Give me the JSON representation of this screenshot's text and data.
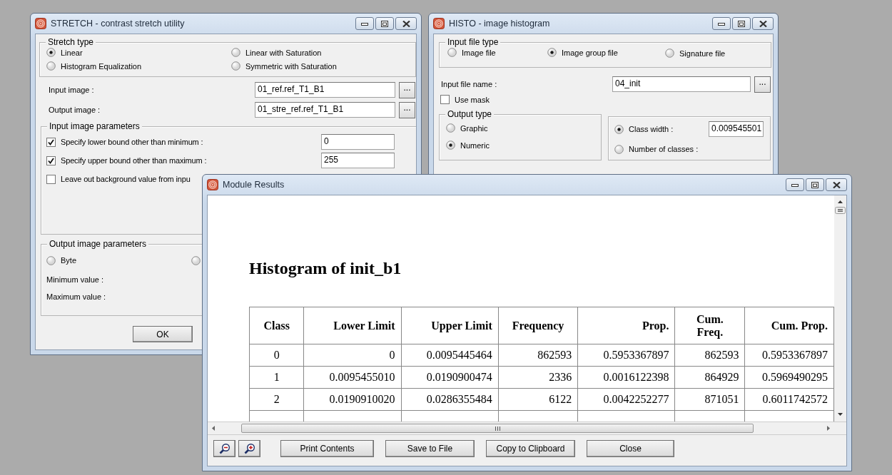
{
  "stretch_window": {
    "title": "STRETCH - contrast stretch utility",
    "stretch_type": {
      "label": "Stretch type",
      "options": [
        {
          "label": "Linear",
          "selected": true
        },
        {
          "label": "Linear with Saturation",
          "selected": false
        },
        {
          "label": "Histogram Equalization",
          "selected": false
        },
        {
          "label": "Symmetric with Saturation",
          "selected": false
        }
      ]
    },
    "fields": [
      {
        "label": "Input image :",
        "value": "01_ref.ref_T1_B1",
        "browse": "..."
      },
      {
        "label": "Output image :",
        "value": "01_stre_ref.ref_T1_B1",
        "browse": "..."
      }
    ],
    "input_parameters": {
      "label": "Input image parameters",
      "options": [
        {
          "label": "Specify lower bound other than minimum :",
          "checked": true,
          "value": "0"
        },
        {
          "label": "Specify upper bound other than maximum :",
          "checked": true,
          "value": "255"
        },
        {
          "label": "Leave out background value from inpu",
          "checked": false
        }
      ]
    },
    "output_parameters": {
      "label": "Output image parameters",
      "options": [
        {
          "label": "Byte",
          "selected": false
        },
        {
          "selected": false
        }
      ],
      "labels": [
        "Minimum value :",
        "Maximum value :"
      ]
    },
    "buttons": [
      "OK"
    ]
  },
  "histo_window": {
    "title": "HISTO - image histogram",
    "input_file_type": {
      "label": "Input file type",
      "options": [
        {
          "label": "Image file",
          "selected": false
        },
        {
          "label": "Image group file",
          "selected": true
        },
        {
          "label": "Signature file",
          "selected": false
        }
      ]
    },
    "input_file": {
      "label": "Input file name :",
      "value": "04_init",
      "browse": "..."
    },
    "use_mask": {
      "label": "Use mask",
      "checked": false
    },
    "output_type": {
      "label": "Output type",
      "options": [
        {
          "label": "Graphic",
          "selected": false
        },
        {
          "label": "Numeric",
          "selected": true
        }
      ]
    },
    "classes": {
      "options": [
        {
          "label": "Class width :",
          "selected": true,
          "value": "0.009545501"
        },
        {
          "label": "Number of classes :",
          "selected": false
        }
      ]
    }
  },
  "results_window": {
    "title": "Module Results",
    "heading": "Histogram of init_b1",
    "table": {
      "columns": [
        "Class",
        "Lower Limit",
        "Upper Limit",
        "Frequency",
        "Prop.",
        "Cum.\nFreq.",
        "Cum. Prop."
      ],
      "rows": [
        [
          "0",
          "0",
          "0.0095445464",
          "862593",
          "0.5953367897",
          "862593",
          "0.5953367897"
        ],
        [
          "1",
          "0.0095455010",
          "0.0190900474",
          "2336",
          "0.0016122398",
          "864929",
          "0.5969490295"
        ],
        [
          "2",
          "0.0190910020",
          "0.0286355484",
          "6122",
          "0.0042252277",
          "871051",
          "0.6011742572"
        ]
      ]
    },
    "buttons": [
      "Print Contents",
      "Save to File",
      "Copy to Clipboard",
      "Close"
    ]
  }
}
